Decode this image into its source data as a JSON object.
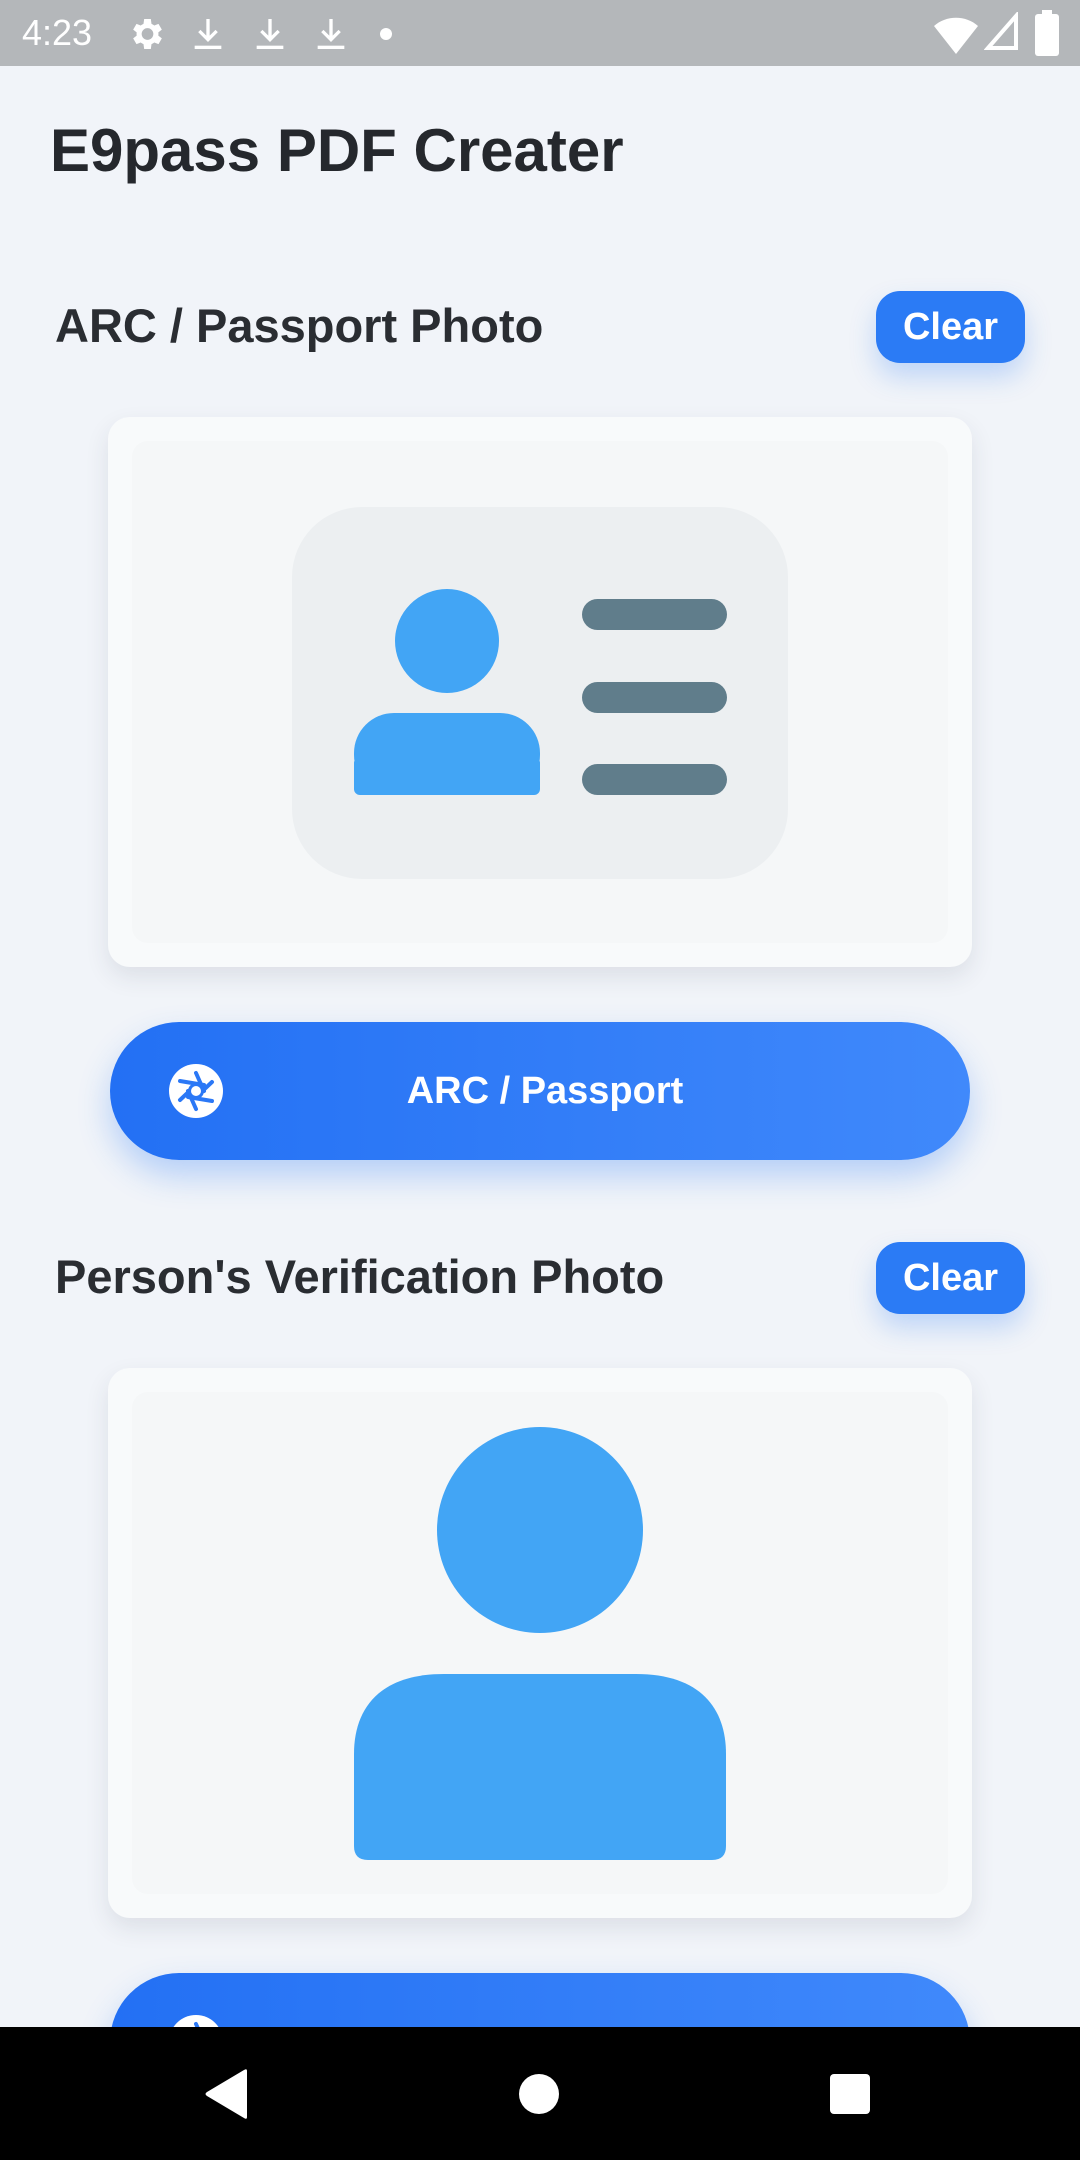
{
  "status_bar": {
    "time": "4:23",
    "icons": [
      "gear-icon",
      "download-icon",
      "download-icon",
      "download-icon",
      "dot-icon",
      "wifi-icon",
      "signal-icon",
      "battery-icon"
    ]
  },
  "app": {
    "title": "E9pass PDF Creater"
  },
  "sections": [
    {
      "title": "ARC / Passport Photo",
      "clear_label": "Clear",
      "placeholder_icon": "id-card-icon",
      "button_label": "ARC / Passport",
      "button_icon": "camera-shutter-icon"
    },
    {
      "title": "Person's Verification Photo",
      "clear_label": "Clear",
      "placeholder_icon": "person-icon",
      "button_label": "",
      "button_icon": "camera-shutter-icon"
    }
  ],
  "colors": {
    "accent": "#2b7bf5",
    "person_blue": "#42a5f5",
    "line_gray": "#607d8b",
    "card_bg": "#eceff1"
  },
  "nav_bar": {
    "icons": [
      "back-icon",
      "home-icon",
      "recents-icon"
    ]
  }
}
